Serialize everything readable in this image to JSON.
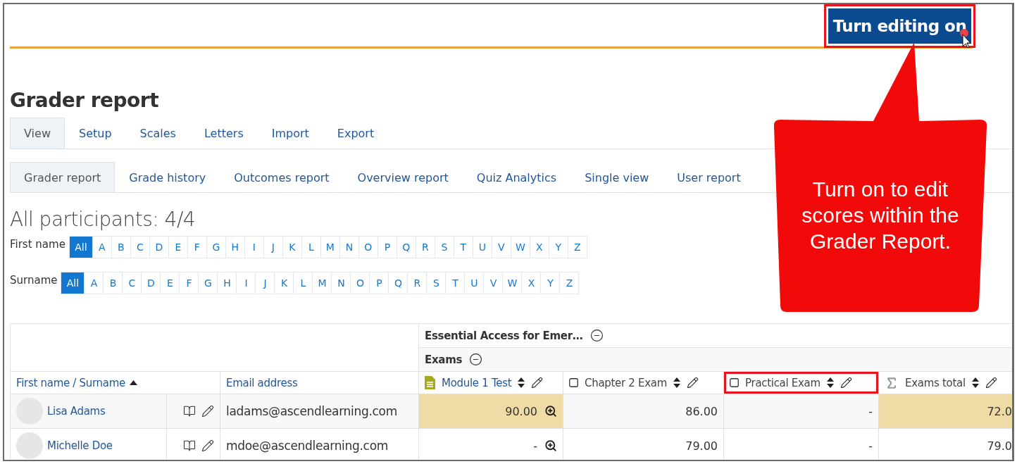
{
  "header": {
    "edit_button": {
      "label": "Turn editing on",
      "highlighted": true
    }
  },
  "title": "Grader report",
  "tabs": [
    {
      "label": "View",
      "selected": true
    },
    {
      "label": "Setup",
      "selected": false
    },
    {
      "label": "Scales",
      "selected": false
    },
    {
      "label": "Letters",
      "selected": false
    },
    {
      "label": "Import",
      "selected": false
    },
    {
      "label": "Export",
      "selected": false
    }
  ],
  "subtabs": [
    {
      "label": "Grader report",
      "selected": true
    },
    {
      "label": "Grade history",
      "selected": false
    },
    {
      "label": "Outcomes report",
      "selected": false
    },
    {
      "label": "Overview report",
      "selected": false
    },
    {
      "label": "Quiz Analytics",
      "selected": false
    },
    {
      "label": "Single view",
      "selected": false
    },
    {
      "label": "User report",
      "selected": false
    }
  ],
  "participants": "All participants: 4/4",
  "initial_bars": [
    {
      "label": "First name",
      "letters": [
        {
          "text": "All",
          "selected": true
        },
        {
          "text": "A",
          "selected": false
        },
        {
          "text": "B",
          "selected": false
        },
        {
          "text": "C",
          "selected": false
        },
        {
          "text": "D",
          "selected": false
        },
        {
          "text": "E",
          "selected": false
        },
        {
          "text": "F",
          "selected": false
        },
        {
          "text": "G",
          "selected": false
        },
        {
          "text": "H",
          "selected": false
        },
        {
          "text": "I",
          "selected": false
        },
        {
          "text": "J",
          "selected": false
        },
        {
          "text": "K",
          "selected": false
        },
        {
          "text": "L",
          "selected": false
        },
        {
          "text": "M",
          "selected": false
        },
        {
          "text": "N",
          "selected": false
        },
        {
          "text": "O",
          "selected": false
        },
        {
          "text": "P",
          "selected": false
        },
        {
          "text": "Q",
          "selected": false
        },
        {
          "text": "R",
          "selected": false
        },
        {
          "text": "S",
          "selected": false
        },
        {
          "text": "T",
          "selected": false
        },
        {
          "text": "U",
          "selected": false
        },
        {
          "text": "V",
          "selected": false
        },
        {
          "text": "W",
          "selected": false
        },
        {
          "text": "X",
          "selected": false
        },
        {
          "text": "Y",
          "selected": false
        },
        {
          "text": "Z",
          "selected": false
        }
      ]
    },
    {
      "label": "Surname",
      "letters": [
        {
          "text": "All",
          "selected": true
        },
        {
          "text": "A",
          "selected": false
        },
        {
          "text": "B",
          "selected": false
        },
        {
          "text": "C",
          "selected": false
        },
        {
          "text": "D",
          "selected": false
        },
        {
          "text": "E",
          "selected": false
        },
        {
          "text": "F",
          "selected": false
        },
        {
          "text": "G",
          "selected": false
        },
        {
          "text": "H",
          "selected": false
        },
        {
          "text": "I",
          "selected": false
        },
        {
          "text": "J",
          "selected": false
        },
        {
          "text": "K",
          "selected": false
        },
        {
          "text": "L",
          "selected": false
        },
        {
          "text": "M",
          "selected": false
        },
        {
          "text": "N",
          "selected": false
        },
        {
          "text": "O",
          "selected": false
        },
        {
          "text": "P",
          "selected": false
        },
        {
          "text": "Q",
          "selected": false
        },
        {
          "text": "R",
          "selected": false
        },
        {
          "text": "S",
          "selected": false
        },
        {
          "text": "T",
          "selected": false
        },
        {
          "text": "U",
          "selected": false
        },
        {
          "text": "V",
          "selected": false
        },
        {
          "text": "W",
          "selected": false
        },
        {
          "text": "X",
          "selected": false
        },
        {
          "text": "Y",
          "selected": false
        },
        {
          "text": "Z",
          "selected": false
        }
      ]
    }
  ],
  "table": {
    "category": "Essential Access for Emer…",
    "subcategory": "Exams",
    "name_column": "First name / Surname",
    "email_column": "Email address",
    "grade_columns": [
      {
        "label": "Module 1 Test",
        "kind": "assignment",
        "highlighted": false
      },
      {
        "label": "Chapter 2 Exam",
        "kind": "manual",
        "highlighted": false
      },
      {
        "label": "Practical Exam",
        "kind": "manual",
        "highlighted": true
      },
      {
        "label": "Exams total",
        "kind": "total",
        "highlighted": false
      }
    ],
    "rows": [
      {
        "name": "Lisa Adams",
        "email": "ladams@ascendlearning.com",
        "grades": [
          {
            "value": "90.00",
            "overridden": true,
            "zoom": true
          },
          {
            "value": "86.00",
            "overridden": false,
            "zoom": false
          },
          {
            "value": "-",
            "overridden": false,
            "zoom": false
          },
          {
            "value": "72.0",
            "overridden": true,
            "zoom": false
          }
        ]
      },
      {
        "name": "Michelle Doe",
        "email": "mdoe@ascendlearning.com",
        "grades": [
          {
            "value": "-",
            "overridden": false,
            "zoom": true
          },
          {
            "value": "79.00",
            "overridden": false,
            "zoom": false
          },
          {
            "value": "-",
            "overridden": false,
            "zoom": false
          },
          {
            "value": "79.0",
            "overridden": false,
            "zoom": false
          }
        ]
      }
    ]
  },
  "callout": {
    "text": "Turn on to edit scores within the Grader Report."
  }
}
